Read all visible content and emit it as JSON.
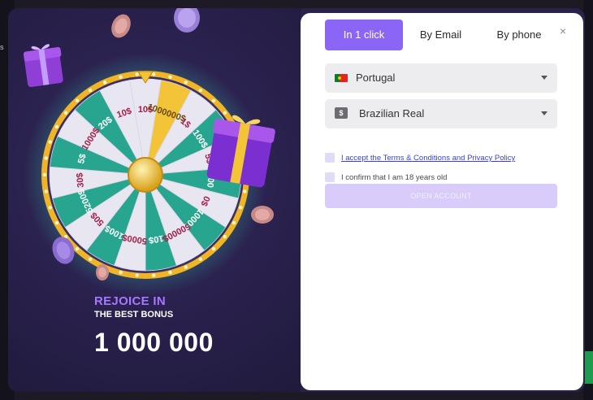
{
  "backdrop": {
    "fragment": "s"
  },
  "promo": {
    "headline": "REJOICE IN",
    "subheadline": "THE BEST BONUS",
    "amount": "1 000 000",
    "wheel_segments": [
      "10$",
      "1000000$",
      "1$",
      "100$",
      "5$",
      "200",
      "0$",
      "1000$",
      "50000$",
      "10$",
      "5000$",
      "100$",
      "50$",
      "5200$",
      "30$",
      "5$",
      "1000$",
      "20$",
      "10$"
    ]
  },
  "form": {
    "tabs": [
      {
        "label": "In 1 click",
        "active": true
      },
      {
        "label": "By Email",
        "active": false
      },
      {
        "label": "By phone",
        "active": false
      }
    ],
    "close_label": "×",
    "country": {
      "value": "Portugal",
      "flag": "portugal-flag"
    },
    "currency": {
      "value": "Brazilian Real",
      "icon": "$"
    },
    "terms_label": "I accept the Terms & Conditions and Privacy Policy",
    "age_label": "I confirm that I am 18 years old",
    "submit_label": "OPEN ACCOUNT"
  },
  "colors": {
    "accent": "#8b65f5",
    "promo_background": "#2b2250",
    "wheel_teal": "#27a58f",
    "wheel_gold": "#f3c437",
    "submit_disabled": "#d9ccfb"
  }
}
